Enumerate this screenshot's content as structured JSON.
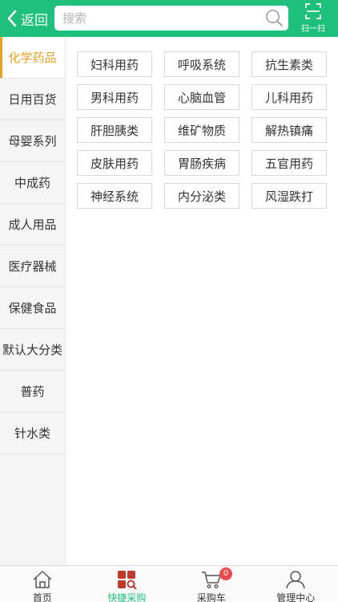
{
  "header": {
    "back_label": "返回",
    "search_placeholder": "搜索",
    "scan_label": "扫一扫"
  },
  "sidebar": {
    "items": [
      {
        "label": "化学药品",
        "active": true
      },
      {
        "label": "日用百货",
        "active": false
      },
      {
        "label": "母婴系列",
        "active": false
      },
      {
        "label": "中成药",
        "active": false
      },
      {
        "label": "成人用品",
        "active": false
      },
      {
        "label": "医疗器械",
        "active": false
      },
      {
        "label": "保健食品",
        "active": false
      },
      {
        "label": "默认大分类",
        "active": false
      },
      {
        "label": "普药",
        "active": false
      },
      {
        "label": "针水类",
        "active": false
      }
    ]
  },
  "categories": [
    "妇科用药",
    "呼吸系统",
    "抗生素类",
    "男科用药",
    "心脑血管",
    "儿科用药",
    "肝胆胰类",
    "维矿物质",
    "解热镇痛",
    "皮肤用药",
    "胃肠疾病",
    "五官用药",
    "神经系统",
    "内分泌类",
    "风湿跌打"
  ],
  "tabbar": {
    "items": [
      {
        "label": "首页",
        "icon": "home-icon"
      },
      {
        "label": "快捷采购",
        "icon": "quick-purchase-icon"
      },
      {
        "label": "采购车",
        "icon": "cart-icon"
      },
      {
        "label": "管理中心",
        "icon": "user-icon"
      }
    ],
    "cart_badge": "0"
  },
  "colors": {
    "primary": "#1fc07c",
    "active_sidebar": "#f0a020",
    "quick_purchase_icon": "#c0392b",
    "badge": "#e84b4b"
  }
}
